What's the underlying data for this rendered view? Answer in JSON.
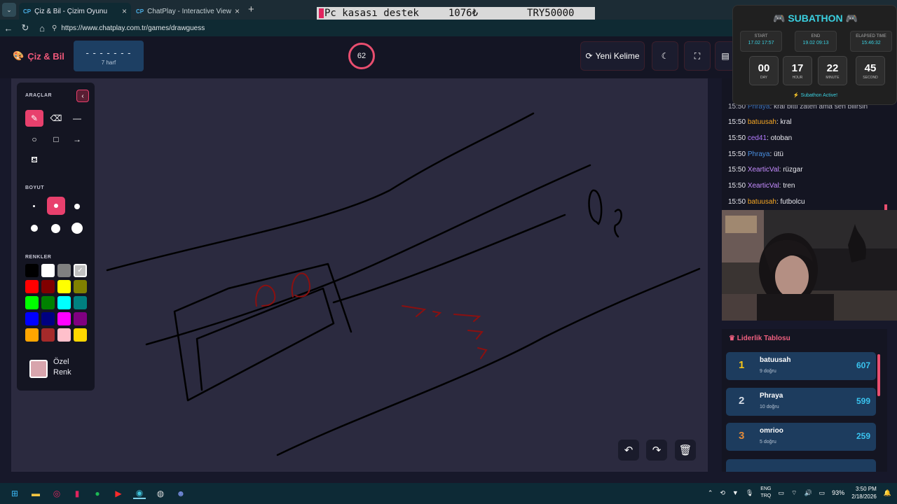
{
  "browser": {
    "tabs": [
      {
        "icon": "CP",
        "title": "Çiz & Bil - Çizim Oyunu",
        "active": true
      },
      {
        "icon": "CP",
        "title": "ChatPlay - Interactive Viewer Gam",
        "active": false
      }
    ],
    "url": "https://www.chatplay.com.tr/games/drawguess"
  },
  "ticker": {
    "part1": "Pc kasası destek",
    "part2": "1076₺",
    "part3": "TRY50000"
  },
  "app": {
    "logo": "Çiz & Bil",
    "word_mask": "- - - - - - -",
    "word_length": "7 harf",
    "timer": "62",
    "new_word_label": "Yeni Kelime"
  },
  "tools": {
    "section_tools": "ARAÇLAR",
    "section_size": "BOYUT",
    "section_colors": "RENKLER",
    "custom_color_label_1": "Özel",
    "custom_color_label_2": "Renk",
    "palette": [
      "#000000",
      "#ffffff",
      "#808080",
      "#c0c0c0",
      "#ff0000",
      "#800000",
      "#ffff00",
      "#808000",
      "#00ff00",
      "#008000",
      "#00ffff",
      "#008080",
      "#0000ff",
      "#000080",
      "#ff00ff",
      "#800080",
      "#ffa500",
      "#a52a2a",
      "#ffc0cb",
      "#ffd700"
    ],
    "custom_color": "#d8a5ad"
  },
  "chat": {
    "messages": [
      {
        "time": "15:50",
        "user": "Phraya",
        "color": "#4a90e2",
        "text": "kral bitti zaten ama sen bilirsin"
      },
      {
        "time": "15:50",
        "user": "batuusah",
        "color": "#f5a623",
        "text": "kral"
      },
      {
        "time": "15:50",
        "user": "ced41",
        "color": "#b47cff",
        "text": "otoban"
      },
      {
        "time": "15:50",
        "user": "Phraya",
        "color": "#4a90e2",
        "text": "ütü"
      },
      {
        "time": "15:50",
        "user": "XearticVal",
        "color": "#c58cff",
        "text": "rüzgar"
      },
      {
        "time": "15:50",
        "user": "XearticVal",
        "color": "#c58cff",
        "text": "tren"
      },
      {
        "time": "15:50",
        "user": "batuusah",
        "color": "#f5a623",
        "text": "futbolcu"
      }
    ]
  },
  "leaderboard": {
    "title": "Liderlik Tablosu",
    "rows": [
      {
        "rank": "1",
        "name": "batuusah",
        "sub": "9 doğru",
        "score": "607",
        "rank_color": "#f5c518"
      },
      {
        "rank": "2",
        "name": "Phraya",
        "sub": "10 doğru",
        "score": "599",
        "rank_color": "#d6dde6"
      },
      {
        "rank": "3",
        "name": "omrioo",
        "sub": "5 doğru",
        "score": "259",
        "rank_color": "#e08a3a"
      }
    ]
  },
  "subathon": {
    "title": "SUBATHON",
    "start_label": "START",
    "start_value": "17.02 17:57",
    "end_label": "END",
    "end_value": "19.02 09:13",
    "elapsed_label": "ELAPSED TIME",
    "elapsed_value": "15:46:32",
    "day": "00",
    "day_label": "DAY",
    "hour": "17",
    "hour_label": "HOUR",
    "minute": "22",
    "minute_label": "MINUTE",
    "second": "45",
    "second_label": "SECOND",
    "status": "Subathon Active!"
  },
  "taskbar": {
    "lang1": "ENG",
    "lang2": "TRQ",
    "battery": "93%",
    "time": "3:50 PM",
    "date": "2/18/2026"
  }
}
